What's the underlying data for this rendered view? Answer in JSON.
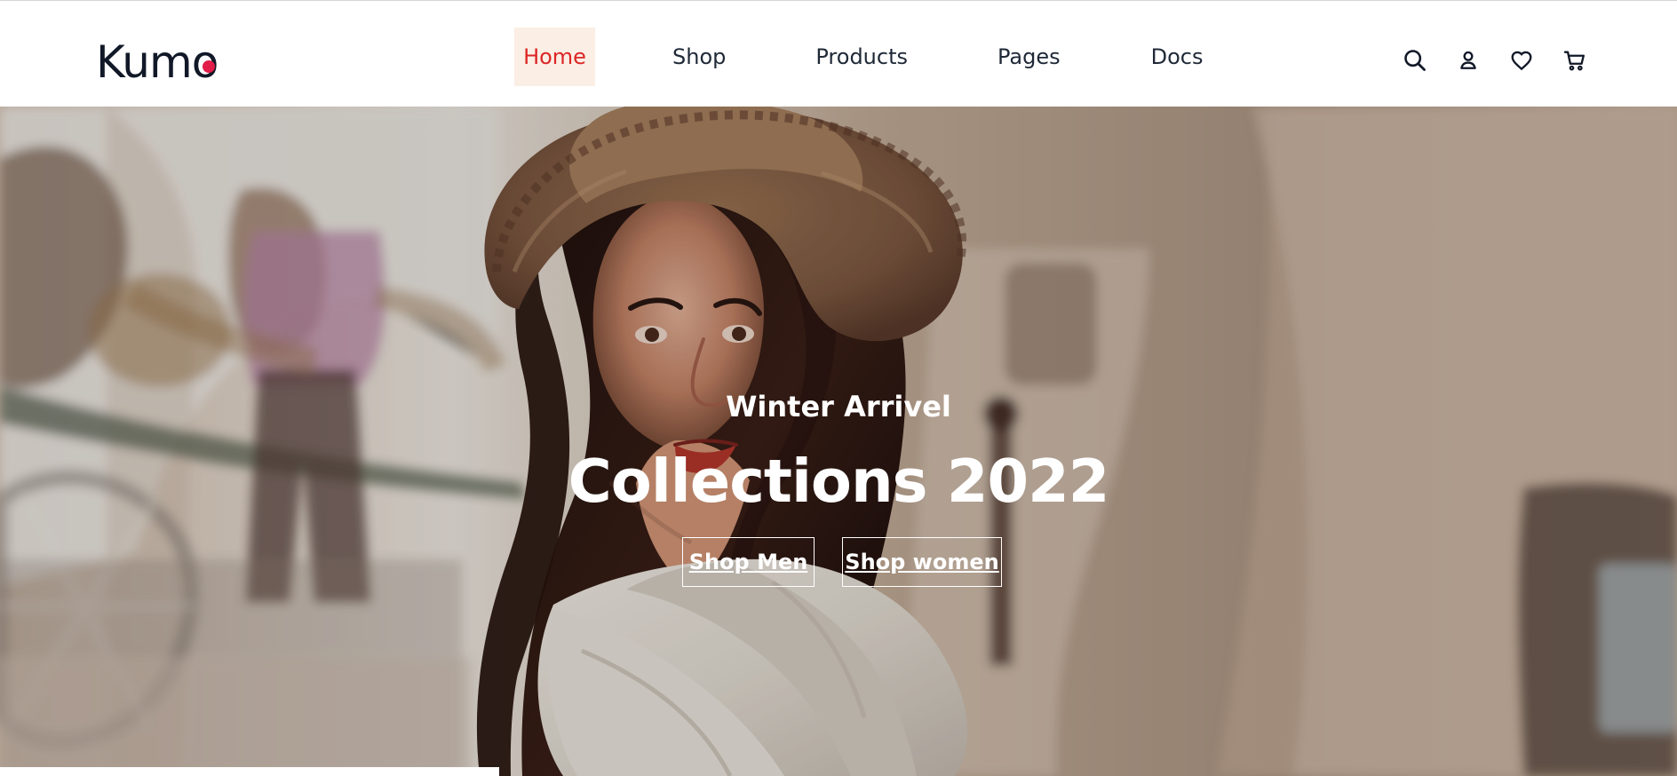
{
  "brand": {
    "name": "Kumo",
    "accent": "#e11d48"
  },
  "navigation": {
    "items": [
      {
        "label": "Home",
        "active": true
      },
      {
        "label": "Shop",
        "active": false
      },
      {
        "label": "Products",
        "active": false
      },
      {
        "label": "Pages",
        "active": false
      },
      {
        "label": "Docs",
        "active": false
      }
    ],
    "active_color": "#dc2626",
    "active_background": "#fbeee4"
  },
  "header_actions": [
    {
      "icon": "search-icon"
    },
    {
      "icon": "user-icon"
    },
    {
      "icon": "heart-icon"
    },
    {
      "icon": "cart-icon"
    }
  ],
  "hero": {
    "subtitle": "Winter Arrivel",
    "title": "Collections 2022",
    "buttons": [
      {
        "label": "Shop Men"
      },
      {
        "label": "Shop women"
      }
    ]
  },
  "cookie_notice": {
    "text": ""
  }
}
